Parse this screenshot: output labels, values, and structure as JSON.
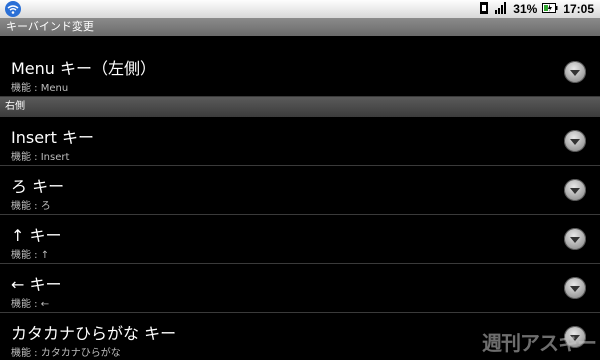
{
  "status_bar": {
    "battery_percent": "31%",
    "time": "17:05",
    "left_icon": "wifi-icon",
    "icons": [
      "sim-icon",
      "signal-icon",
      "battery-icon"
    ]
  },
  "title_bar": {
    "title": "キーバインド変更"
  },
  "top_item": {
    "title": "Menu キー（左側）",
    "subtitle": "機能 : Menu"
  },
  "section": {
    "label": "右側"
  },
  "items": [
    {
      "title": "Insert キー",
      "subtitle": "機能 : Insert"
    },
    {
      "title": "ろ キー",
      "subtitle": "機能 : ろ"
    },
    {
      "title": "↑ キー",
      "subtitle": "機能 : ↑"
    },
    {
      "title": "← キー",
      "subtitle": "機能 : ←"
    },
    {
      "title": "カタカナひらがな キー",
      "subtitle": "機能 : カタカナひらがな"
    }
  ],
  "watermark": "週刊アスキー"
}
